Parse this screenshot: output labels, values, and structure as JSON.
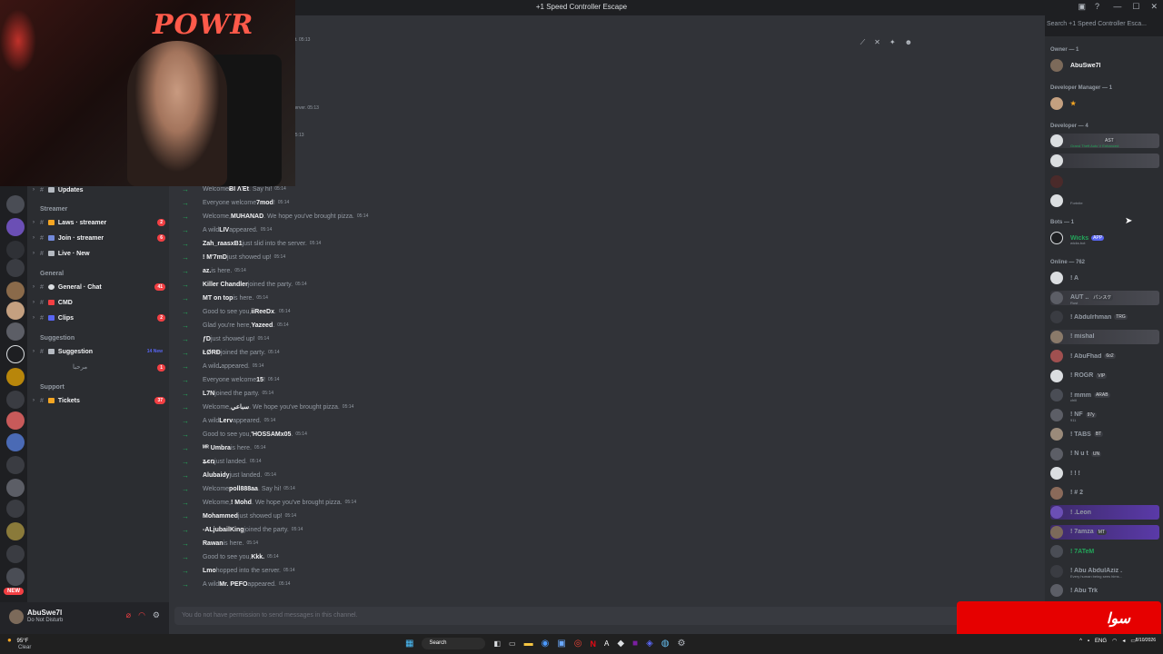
{
  "window": {
    "title": "+1 Speed Controller Escape",
    "controls": [
      "—",
      "☐",
      "✕"
    ]
  },
  "search": {
    "placeholder": "Search +1 Speed Controller Esca..."
  },
  "sidebar": {
    "updates": "Updates",
    "cat_streamer": "Streamer",
    "laws": "Laws · streamer",
    "laws_count": "2",
    "join": "Join · streamer",
    "join_count": "6",
    "live": "Live · New",
    "cat_general": "General",
    "general_chat": "General · Chat",
    "general_count": "41",
    "cmd": "CMD",
    "clips": "Clips",
    "clips_count": "2",
    "cat_suggestion": "Suggestion",
    "suggestion": "Suggestion",
    "suggestion_new": "14 New",
    "sub_thread": "مرحبا",
    "sub_count": "1",
    "cat_support": "Support",
    "tickets": "Tickets",
    "tickets_count": "37"
  },
  "rail": {
    "new_badge": "NEW"
  },
  "user": {
    "name": "AbuSwe7l",
    "status": "Do Not Disturb"
  },
  "messages": [
    {
      "pre": "Welcome ",
      "user": "Ƀl ΛΈt",
      "post": ". Say hi!",
      "time": "05:14"
    },
    {
      "pre": "Everyone welcome ",
      "user": "7mod",
      "post": "!",
      "time": "05:14"
    },
    {
      "pre": "Welcome, ",
      "user": "MUHANAD",
      "post": ". We hope you've brought pizza.",
      "time": "05:14"
    },
    {
      "pre": "A wild ",
      "user": "LIV",
      "post": " appeared.",
      "time": "05:14"
    },
    {
      "pre": "",
      "user": "Zah_raasxB1",
      "post": " just slid into the server.",
      "time": "05:14"
    },
    {
      "pre": "",
      "user": "! M'7mD",
      "post": " just showed up!",
      "time": "05:14"
    },
    {
      "pre": "",
      "user": "az.",
      "post": " is here.",
      "time": "05:14"
    },
    {
      "pre": "",
      "user": "Killer Chandler",
      "post": " joined the party.",
      "time": "05:14"
    },
    {
      "pre": "",
      "user": "MT on top",
      "post": " is here.",
      "time": "05:14"
    },
    {
      "pre": "Good to see you, ",
      "user": "iiReeDx",
      "post": ".",
      "time": "05:14"
    },
    {
      "pre": "Glad you're here, ",
      "user": "Yazeed",
      "post": ".",
      "time": "05:14"
    },
    {
      "pre": "",
      "user": "ƒD",
      "post": " just showed up!",
      "time": "05:14"
    },
    {
      "pre": "",
      "user": "ŁØRĐ",
      "post": " joined the party.",
      "time": "05:14"
    },
    {
      "pre": "A wild ",
      "user": ".",
      "post": " appeared.",
      "time": "05:14"
    },
    {
      "pre": "Everyone welcome ",
      "user": "15",
      "post": "!",
      "time": "05:14"
    },
    {
      "pre": "",
      "user": "L7N",
      "post": " joined the party.",
      "time": "05:14"
    },
    {
      "pre": "Welcome, ",
      "user": "ﺳﺒﺎﻋﻲ",
      "post": ". We hope you've brought pizza.",
      "time": "05:14"
    },
    {
      "pre": "A wild ",
      "user": "Lerv",
      "post": " appeared.",
      "time": "05:14"
    },
    {
      "pre": "Good to see you, ",
      "user": "'HOSSAMx05",
      "post": ".",
      "time": "05:14"
    },
    {
      "pre": "",
      "user": "ᴹᴿ Umbra",
      "post": " is here.",
      "time": "05:14"
    },
    {
      "pre": "",
      "user": "ʑєռ",
      "post": " just landed.",
      "time": "05:14"
    },
    {
      "pre": "",
      "user": "Alubaidy",
      "post": " just landed.",
      "time": "05:14"
    },
    {
      "pre": "Welcome ",
      "user": "poll888aa",
      "post": ". Say hi!",
      "time": "05:14"
    },
    {
      "pre": "Welcome, ",
      "user": "! Mohd",
      "post": ". We hope you've brought pizza.",
      "time": "05:14"
    },
    {
      "pre": "",
      "user": "Mohammed",
      "post": " just showed up!",
      "time": "05:14"
    },
    {
      "pre": "",
      "user": "-ALjubailKing",
      "post": " joined the party.",
      "time": "05:14"
    },
    {
      "pre": "",
      "user": "Rawan",
      "post": " is here.",
      "time": "05:14"
    },
    {
      "pre": "Good to see you, ",
      "user": "Kkk.",
      "post": "",
      "time": "05:14"
    },
    {
      "pre": "",
      "user": "Lmo",
      "post": " hopped into the server.",
      "time": "05:14"
    },
    {
      "pre": "A wild ",
      "user": "Mr. PEFO",
      "post": " appeared.",
      "time": "05:14"
    }
  ],
  "old_messages": [
    {
      "text": "nt. 05:13"
    },
    {
      "text": "server. 05:13"
    },
    {
      "text": "05:13"
    }
  ],
  "composer": {
    "placeholder": "You do not have permission to send messages in this channel."
  },
  "members": {
    "owner_cat": "Owner — 1",
    "owner": "AbuSwe7l",
    "devmgr_cat": "Developer Manager — 1",
    "dev_cat": "Developer — 4",
    "dev_activity_1": "Grand Theft Auto V Enhanced",
    "dev_tag_1": "AST",
    "dev_activity_4": "Fortnite",
    "bots_cat": "Bots — 1",
    "bot": "Wicks",
    "bot_tag": "APP",
    "bot_sub": "wicks.bot",
    "online_cat": "Online — 762",
    "online": [
      {
        "n": "! A",
        "tag": "",
        "sub": ""
      },
      {
        "n": "AUT ..",
        "tag": "パンスケ",
        "sub": "Rust"
      },
      {
        "n": "! Abdulrhman",
        "tag": "TRG",
        "sub": ""
      },
      {
        "n": "! mishal",
        "tag": "",
        "sub": ""
      },
      {
        "n": "! AbuFhad",
        "tag": "6o2",
        "sub": ""
      },
      {
        "n": "! ROGR",
        "tag": "VIP",
        "sub": ""
      },
      {
        "n": "! mmm",
        "tag": "ARAB",
        "sub": "chill"
      },
      {
        "n": "! NF",
        "tag": "97y",
        "sub": "911"
      },
      {
        "n": "! TABS",
        "tag": "BT",
        "sub": ""
      },
      {
        "n": "! N u t",
        "tag": "UN",
        "sub": ""
      },
      {
        "n": "! ! !",
        "tag": "",
        "sub": ""
      },
      {
        "n": "! # 2",
        "tag": "",
        "sub": ""
      },
      {
        "n": "! .Leon",
        "tag": "",
        "sub": ""
      },
      {
        "n": "! 7amza",
        "tag": "MT",
        "sub": ""
      },
      {
        "n": "! 7ATeM",
        "tag": "",
        "sub": ""
      },
      {
        "n": "! Abu AbdulAziz .",
        "tag": "",
        "sub": "Every human being sees hims..."
      },
      {
        "n": "! Abu Trk",
        "tag": "",
        "sub": ""
      }
    ]
  },
  "taskbar": {
    "temp": "95°F",
    "weather": "Clear",
    "search": "Search",
    "lang": "ENG",
    "date": "8/10/2026"
  },
  "overlay": {
    "logo": "ﺳﻮﺍ"
  },
  "webcam": {
    "neon_sign": "POWR"
  }
}
